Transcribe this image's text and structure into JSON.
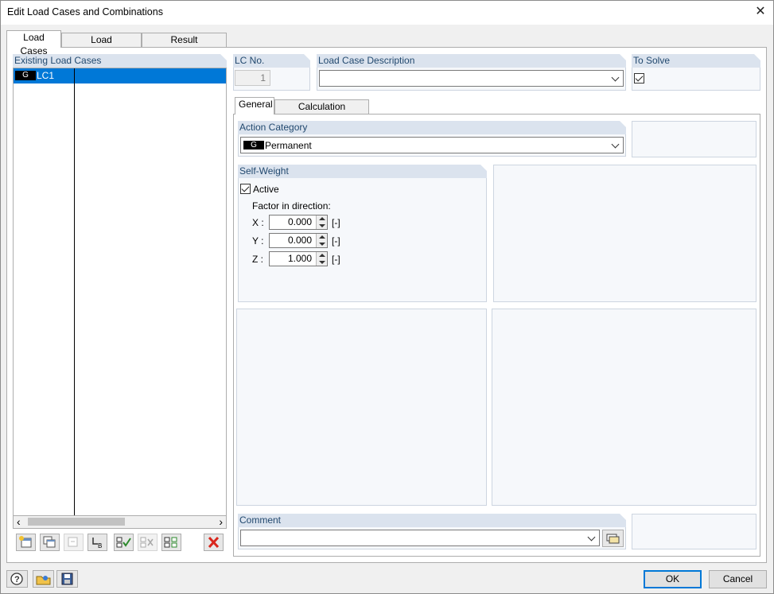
{
  "window": {
    "title": "Edit Load Cases and Combinations",
    "close_icon": "✕"
  },
  "tabs": [
    {
      "label": "Load Cases"
    },
    {
      "label": "Load Combinations"
    },
    {
      "label": "Result Combinations"
    }
  ],
  "existing": {
    "header": "Existing Load Cases",
    "rows": [
      {
        "tag": "G",
        "name": "LC1"
      }
    ]
  },
  "lc_no": {
    "header": "LC No.",
    "value": "1"
  },
  "description": {
    "header": "Load Case Description",
    "value": ""
  },
  "to_solve": {
    "header": "To Solve",
    "checked": true
  },
  "subtabs": [
    {
      "label": "General"
    },
    {
      "label": "Calculation Parameters"
    }
  ],
  "action_category": {
    "header": "Action Category",
    "tag": "G",
    "value": "Permanent"
  },
  "self_weight": {
    "header": "Self-Weight",
    "active_label": "Active",
    "active": true,
    "factor_label": "Factor in direction:",
    "factors": [
      {
        "axis": "X :",
        "value": "0.000",
        "unit": "[-]"
      },
      {
        "axis": "Y :",
        "value": "0.000",
        "unit": "[-]"
      },
      {
        "axis": "Z :",
        "value": "1.000",
        "unit": "[-]"
      }
    ]
  },
  "comment": {
    "header": "Comment",
    "value": ""
  },
  "scroll": {
    "left": "‹",
    "right": "›"
  },
  "buttons": {
    "ok": "OK",
    "cancel": "Cancel"
  },
  "colors": {
    "accent": "#0078d7",
    "group_header": "#dbe3ee",
    "group_text": "#22496f",
    "delete_red": "#d9261c"
  }
}
